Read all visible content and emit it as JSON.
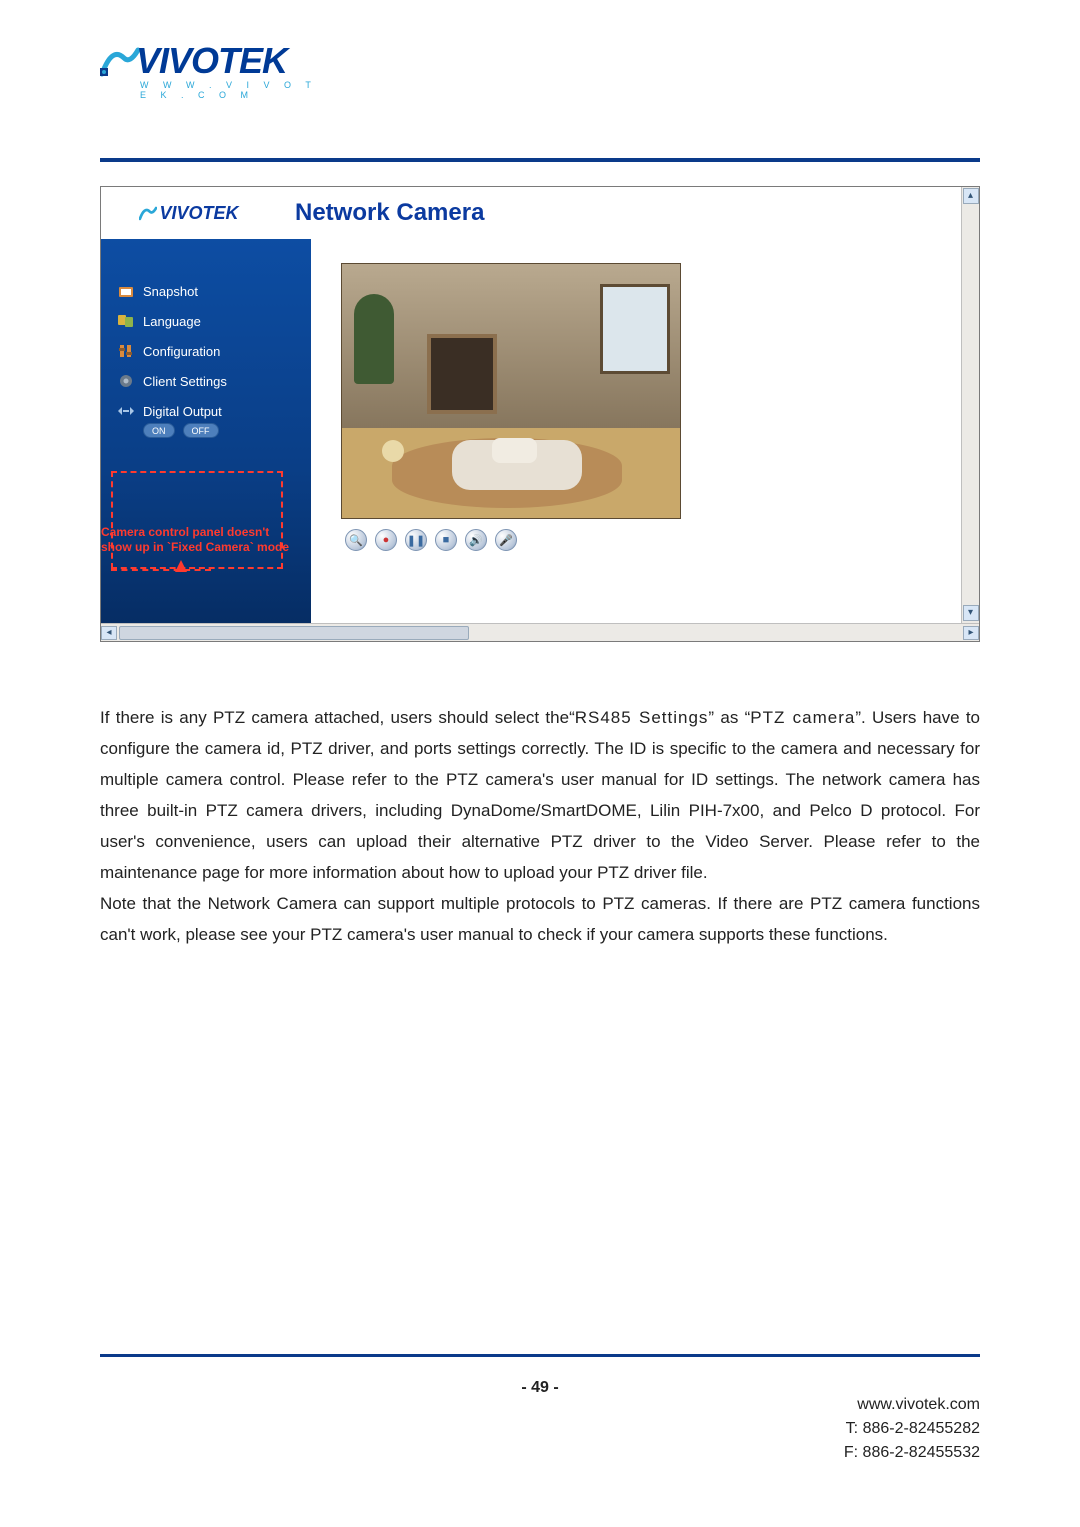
{
  "brand": {
    "name": "VIVOTEK",
    "sub": "W W W . V I V O T E K . C O M"
  },
  "screenshot": {
    "title": "Network Camera",
    "sidebar": {
      "items": [
        {
          "label": "Snapshot",
          "icon": "snapshot-icon"
        },
        {
          "label": "Language",
          "icon": "language-icon"
        },
        {
          "label": "Configuration",
          "icon": "configuration-icon"
        },
        {
          "label": "Client Settings",
          "icon": "client-settings-icon"
        },
        {
          "label": "Digital Output",
          "icon": "digital-output-icon"
        }
      ],
      "digital_output": {
        "on": "ON",
        "off": "OFF"
      }
    },
    "annotation_line1": "Camera control panel doesn't",
    "annotation_line2": "show up in `Fixed Camera` mode",
    "controls": {
      "zoom": "🔍",
      "record": "●",
      "pause": "❚❚",
      "stop": "■",
      "vol": "🔊",
      "mic": "🎤"
    }
  },
  "body": {
    "p1a": "If there is any PTZ camera attached, users should select the",
    "p1_quote1": "“",
    "p1_setting": "RS485 Settings",
    "p1_quote2": "”",
    "p1b": " as ",
    "p1_quote3": "“",
    "p1_ptz": "PTZ camera",
    "p1_quote4": "”",
    "p1c": ". Users have to configure the camera id, PTZ driver, and ports settings correctly. The ID is specific to the camera and necessary for multiple camera control. Please refer to the PTZ camera's user manual for ID settings. The network camera has three built-in PTZ camera drivers, including DynaDome/SmartDOME, Lilin PIH-7x00, and Pelco D protocol. For user's convenience, users can upload their alternative PTZ driver to the Video Server. Please refer to the maintenance page for more information about how to upload your PTZ driver file.",
    "p2": "Note that the Network Camera can support multiple protocols to PTZ cameras. If there are PTZ camera functions can't work, please see your PTZ camera's user manual to check if your camera supports these functions."
  },
  "footer": {
    "page_number": "- 49 -",
    "url": "www.vivotek.com",
    "tel": "T: 886-2-82455282",
    "fax": "F: 886-2-82455532"
  }
}
